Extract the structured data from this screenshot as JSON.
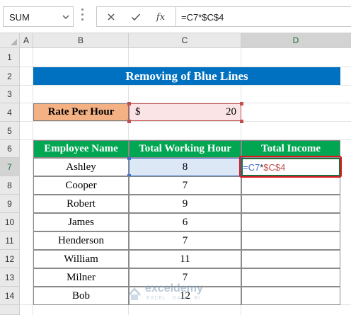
{
  "name_box": {
    "value": "SUM"
  },
  "formula_bar": {
    "cancel_icon": "close-icon",
    "enter_icon": "check-icon",
    "fx_label": "fx",
    "formula": "=C7*$C$4"
  },
  "columns": [
    "A",
    "B",
    "C",
    "D"
  ],
  "rows": [
    "1",
    "2",
    "3",
    "4",
    "5",
    "6",
    "7",
    "8",
    "9",
    "10",
    "11",
    "12",
    "13",
    "14"
  ],
  "title": "Removing of Blue Lines",
  "rate": {
    "label": "Rate Per Hour",
    "currency": "$",
    "value": "20"
  },
  "table": {
    "headers": [
      "Employee Name",
      "Total Working Hour",
      "Total Income"
    ],
    "rows": [
      {
        "name": "Ashley",
        "hours": "8"
      },
      {
        "name": "Cooper",
        "hours": "7"
      },
      {
        "name": "Robert",
        "hours": "9"
      },
      {
        "name": "James",
        "hours": "6"
      },
      {
        "name": "Henderson",
        "hours": "7"
      },
      {
        "name": "William",
        "hours": "11"
      },
      {
        "name": "Milner",
        "hours": "7"
      },
      {
        "name": "Bob",
        "hours": "12"
      }
    ]
  },
  "edit_cell": {
    "part1": "=",
    "ref1": "C7",
    "op": "*",
    "ref2": "$C$4"
  },
  "watermark": {
    "name": "exceldemy",
    "sub": "EXCEL · DATA · BI"
  },
  "colors": {
    "title_bg": "#0070c0",
    "header_bg": "#00a651",
    "rate_label_bg": "#f4b183",
    "rate_value_bg": "#fbe4e5",
    "highlight_red": "#e2171d"
  }
}
